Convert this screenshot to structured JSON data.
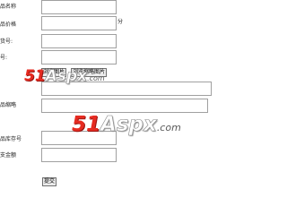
{
  "form": {
    "fields": [
      {
        "label": "品名称",
        "value": "",
        "unit": ""
      },
      {
        "label": "品价格",
        "value": "",
        "unit": "分"
      },
      {
        "label": "货号:",
        "value": "",
        "unit": ""
      },
      {
        "label": "号:",
        "value": "",
        "unit": ""
      }
    ],
    "upload_buttons": [
      "浏览图片",
      "浏览缩略图片"
    ],
    "image_path_value": "",
    "thumbnail": {
      "label": "品缩略",
      "value": ""
    },
    "extra_fields": [
      {
        "label": "品库存号",
        "value": ""
      },
      {
        "label": "支金额",
        "value": ""
      }
    ],
    "submit_label": "提交"
  },
  "watermark": {
    "number": "51",
    "brand": "Aspx",
    "tld": ".com"
  }
}
